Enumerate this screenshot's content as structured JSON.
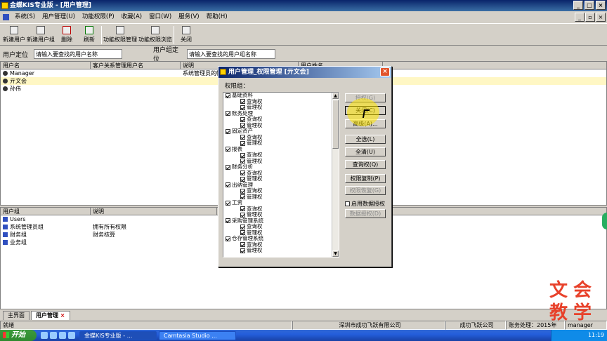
{
  "window": {
    "title": "金蝶KIS专业版 - [用户管理]"
  },
  "menu": [
    "系统(S)",
    "用户管理(U)",
    "功能权限(P)",
    "收藏(A)",
    "窗口(W)",
    "服务(V)",
    "帮助(H)"
  ],
  "toolbar": [
    "新建用户",
    "新建用户组",
    "删除",
    "刷新",
    "功能权限管理",
    "功能权限浏览",
    "关闭"
  ],
  "locate": {
    "user_label": "用户定位",
    "user_placeholder": "请输入要查找的用户名称",
    "group_label": "用户组定位",
    "group_placeholder": "请输入要查找的用户组名称"
  },
  "users_grid": {
    "headers": [
      "用户名",
      "客户关系管理用户名",
      "说明",
      "用户姓名"
    ],
    "rows": [
      {
        "name": "Manager",
        "crm": "",
        "desc": "系统管理员的帐"
      },
      {
        "name": "亓文会",
        "crm": "",
        "desc": ""
      },
      {
        "name": "孙伟",
        "crm": "",
        "desc": ""
      }
    ]
  },
  "groups_grid": {
    "headers": [
      "用户组",
      "说明"
    ],
    "rows": [
      {
        "name": "Users",
        "desc": ""
      },
      {
        "name": "系统管理员组",
        "desc": "拥有所有权限"
      },
      {
        "name": "财务组",
        "desc": "财务核算"
      },
      {
        "name": "业务组",
        "desc": ""
      }
    ]
  },
  "dialog": {
    "title": "用户管理_权限管理 [亓文会]",
    "group_label": "权限组：",
    "tree": [
      {
        "label": "基础资料",
        "children": [
          "查询权",
          "管理权"
        ]
      },
      {
        "label": "账务处理",
        "children": [
          "查询权",
          "管理权"
        ]
      },
      {
        "label": "固定资产",
        "children": [
          "查询权",
          "管理权"
        ]
      },
      {
        "label": "报表",
        "children": [
          "查询权",
          "管理权"
        ]
      },
      {
        "label": "财务分析",
        "children": [
          "查询权",
          "管理权"
        ]
      },
      {
        "label": "出纳管理",
        "children": [
          "查询权",
          "管理权"
        ]
      },
      {
        "label": "工资",
        "children": [
          "查询权",
          "管理权"
        ]
      },
      {
        "label": "采购管理系统",
        "children": [
          "查询权",
          "管理权"
        ]
      },
      {
        "label": "仓存管理系统",
        "children": [
          "查询权",
          "管理权"
        ]
      }
    ],
    "buttons": {
      "grant": "授权(G)",
      "close": "关闭(C)",
      "advanced": "高级(A)...",
      "select_all": "全选(L)",
      "clear_all": "全清(U)",
      "query": "查询权(Q)",
      "copy": "权限复制(P)",
      "restore": "权限恢复(G)",
      "enable_data": "启用数据授权",
      "data_grant": "数据授权(D)"
    }
  },
  "tabs": [
    "主界面",
    "用户管理"
  ],
  "status": {
    "left": "就绪",
    "company": "深圳市成功飞跃有限公司",
    "org": "成功飞跃公司",
    "period": "账务处理：2015年",
    "user": "manager"
  },
  "taskbar": {
    "start": "开始",
    "tasks": [
      "金蝶KIS专业版 - ...",
      "Camtasia Studio ..."
    ],
    "clock": "11:19"
  },
  "watermark": [
    "文",
    "会",
    "教",
    "学"
  ]
}
